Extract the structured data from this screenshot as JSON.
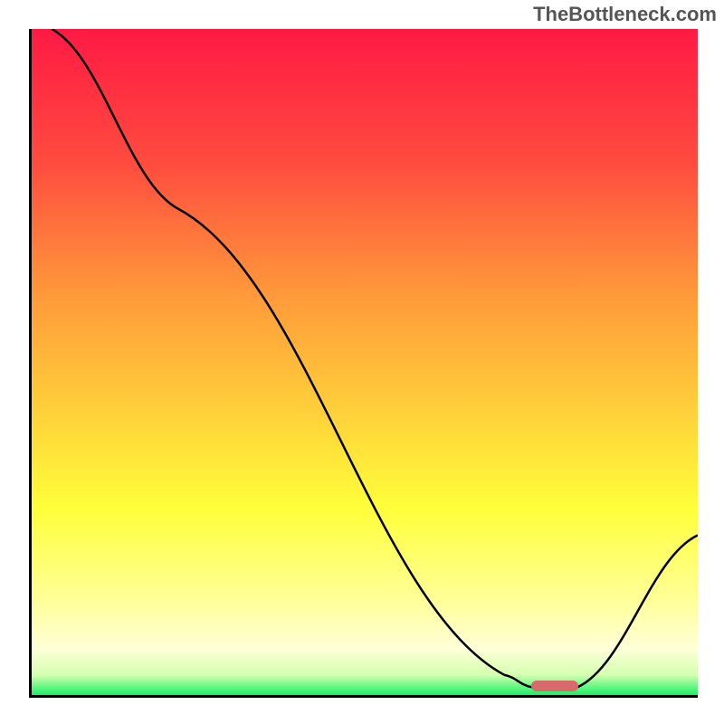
{
  "watermark": "TheBottleneck.com",
  "chart_data": {
    "type": "line",
    "title": "",
    "xlabel": "",
    "ylabel": "",
    "xlim": [
      0,
      100
    ],
    "ylim": [
      0,
      100
    ],
    "gradient_stops": [
      {
        "offset": 0,
        "color": "#ff1a44"
      },
      {
        "offset": 20,
        "color": "#ff4b3f"
      },
      {
        "offset": 40,
        "color": "#ff9a3a"
      },
      {
        "offset": 58,
        "color": "#ffd23a"
      },
      {
        "offset": 72,
        "color": "#ffff3a"
      },
      {
        "offset": 86,
        "color": "#ffff9a"
      },
      {
        "offset": 93,
        "color": "#ffffd8"
      },
      {
        "offset": 97,
        "color": "#d4ffb0"
      },
      {
        "offset": 100,
        "color": "#18f064"
      }
    ],
    "series": [
      {
        "name": "bottleneck-curve",
        "points": [
          {
            "x": 3,
            "y": 100
          },
          {
            "x": 22,
            "y": 73
          },
          {
            "x": 71,
            "y": 3
          },
          {
            "x": 75,
            "y": 1.2
          },
          {
            "x": 82,
            "y": 1.2
          },
          {
            "x": 100,
            "y": 24
          }
        ]
      }
    ],
    "marker": {
      "x_start": 75,
      "x_end": 82,
      "y": 1.3
    }
  }
}
